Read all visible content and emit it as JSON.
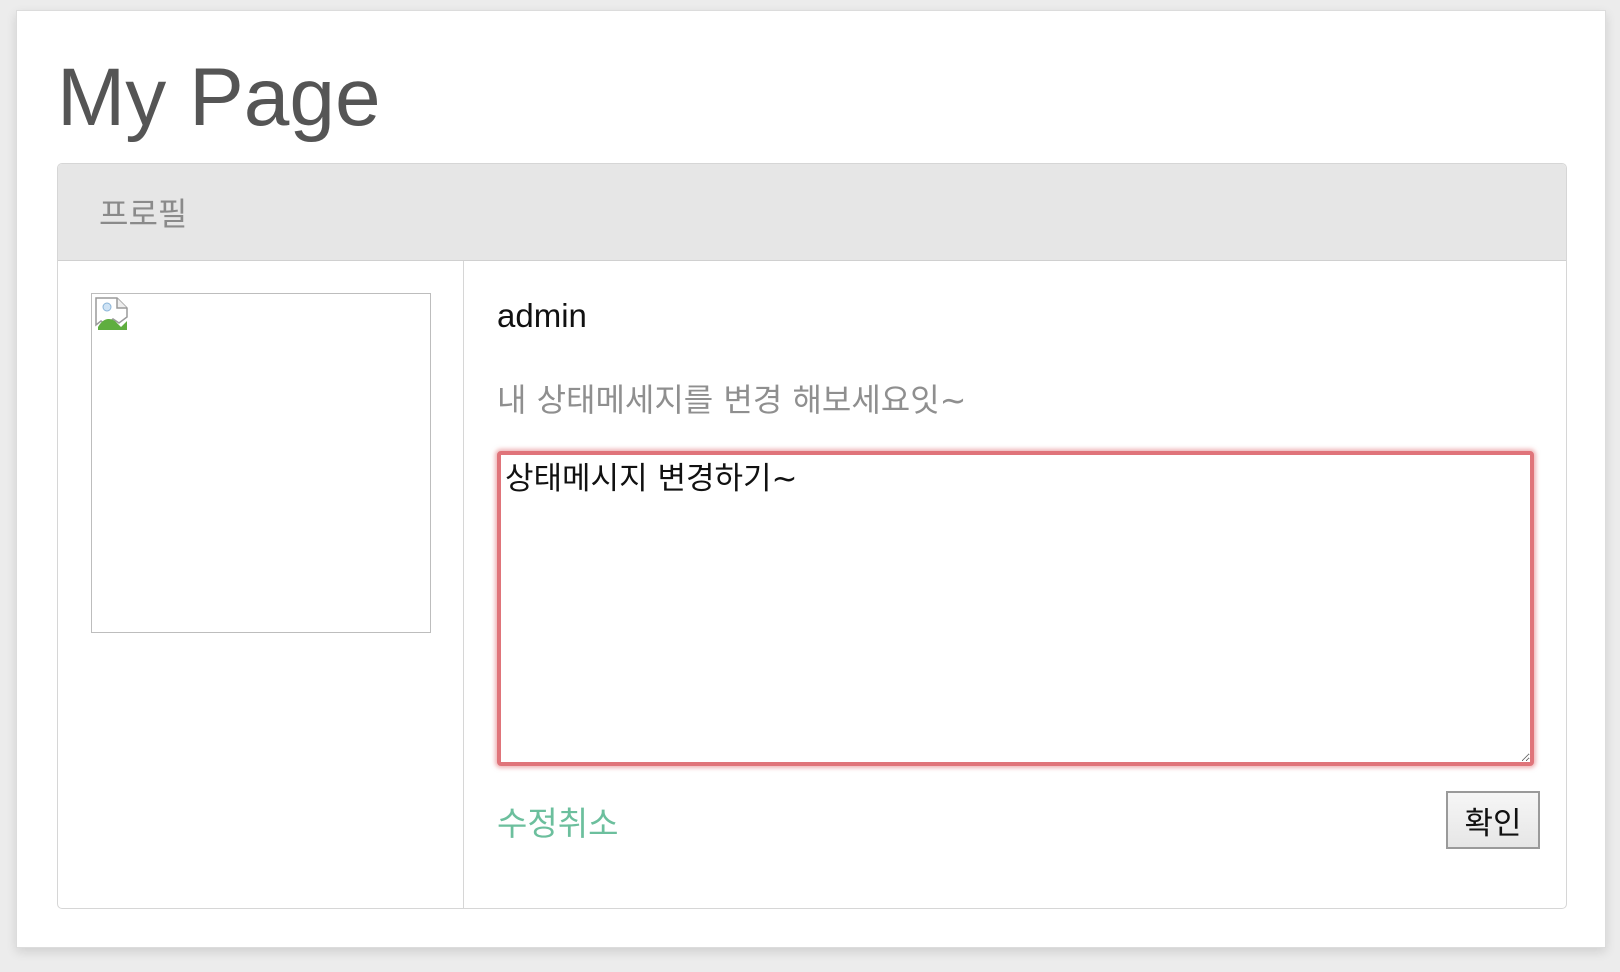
{
  "page": {
    "title": "My Page"
  },
  "panel": {
    "header_title": "프로필"
  },
  "profile": {
    "username": "admin",
    "status_message": "내 상태메세지를 변경 해보세요잇~",
    "image_alt": "profile-image"
  },
  "edit": {
    "textarea_value": "상태메시지 변경하기~",
    "cancel_label": "수정취소",
    "confirm_label": "확인"
  },
  "colors": {
    "focus_border": "#e0747a",
    "link": "#6cbf9d",
    "header_bg": "#e6e6e6"
  }
}
